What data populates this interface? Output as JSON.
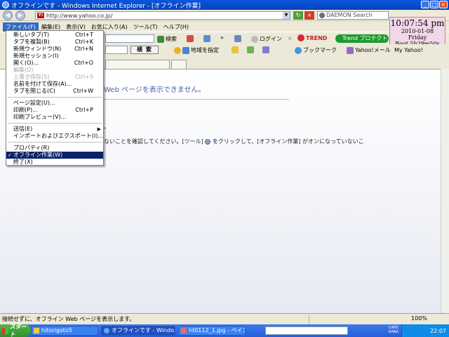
{
  "window": {
    "title": "オフラインです - Windows Internet Explorer - [オフライン作業]",
    "controls": {
      "minimize": "_",
      "maximize": "□",
      "close": "×"
    }
  },
  "address_bar": {
    "url": "http://www.yahoo.co.jp/",
    "favicon_text": "Y!",
    "search_placeholder": "DAEMON Search"
  },
  "clock": {
    "time": "10:07:54 pm",
    "date": "2010-01-08",
    "day": "Friday",
    "boot": "Boot  5h29m50s"
  },
  "menubar": [
    {
      "label": "ファイル(F)"
    },
    {
      "label": "編集(E)"
    },
    {
      "label": "表示(V)"
    },
    {
      "label": "お気に入り(A)"
    },
    {
      "label": "ツール(T)"
    },
    {
      "label": "ヘルプ(H)"
    }
  ],
  "toolbar": {
    "search_label": "検索",
    "login_label": "ログイン",
    "trend_text": "TREND",
    "trend_button": "Trend プロテクト™",
    "search_button": "検 索",
    "map_label": "地域を指定",
    "bookmark_label": "ブックマーク",
    "yahoo_mail": "Yahoo!メール",
    "my_yahoo": "My Yahoo!"
  },
  "file_menu": [
    {
      "label": "新しいタブ(T)",
      "shortcut": "Ctrl+T"
    },
    {
      "label": "タブを複製(B)",
      "shortcut": "Ctrl+K"
    },
    {
      "label": "新規ウィンドウ(N)",
      "shortcut": "Ctrl+N"
    },
    {
      "label": "新規セッション(I)",
      "shortcut": ""
    },
    {
      "label": "開く(O)...",
      "shortcut": "Ctrl+O"
    },
    {
      "label": "編集(D)",
      "shortcut": ""
    },
    {
      "label": "上書き保存(S)",
      "shortcut": "Ctrl+S"
    },
    {
      "label": "名前を付けて保存(A)...",
      "shortcut": ""
    },
    {
      "label": "タブを閉じる(C)",
      "shortcut": "Ctrl+W"
    },
    {
      "label": "ページ設定(U)...",
      "shortcut": ""
    },
    {
      "label": "印刷(P)...",
      "shortcut": "Ctrl+P"
    },
    {
      "label": "印刷プレビュー(V)...",
      "shortcut": ""
    },
    {
      "label": "送信(E)",
      "shortcut": ""
    },
    {
      "label": "インポートおよびエクスポート(I)...",
      "shortcut": ""
    },
    {
      "label": "プロパティ(R)",
      "shortcut": ""
    },
    {
      "label": "オフライン作業(W)",
      "shortcut": ""
    },
    {
      "label": "終了(X)",
      "shortcut": ""
    }
  ],
  "menu_markers": {
    "check": "✓",
    "submenu": "▶"
  },
  "content": {
    "heading": "Web ページを表示できません。",
    "mid_text": "。",
    "body_text": "ないことを確認してください。[ツール]",
    "body_text_2": "をクリックして、[オフライン作業] がオンになっていないこ"
  },
  "status": {
    "text": "接続せずに、オフライン Web ページを表示します。",
    "zoom": "100%"
  },
  "taskbar": {
    "start": "スタート",
    "tasks": [
      {
        "label": "hitorigoto5"
      },
      {
        "label": "オフラインです - Windo..."
      },
      {
        "label": "ht0112_1.jpg - ペイント"
      }
    ],
    "caps": "CAPS",
    "kana": "KANA",
    "clock": "22:07"
  }
}
